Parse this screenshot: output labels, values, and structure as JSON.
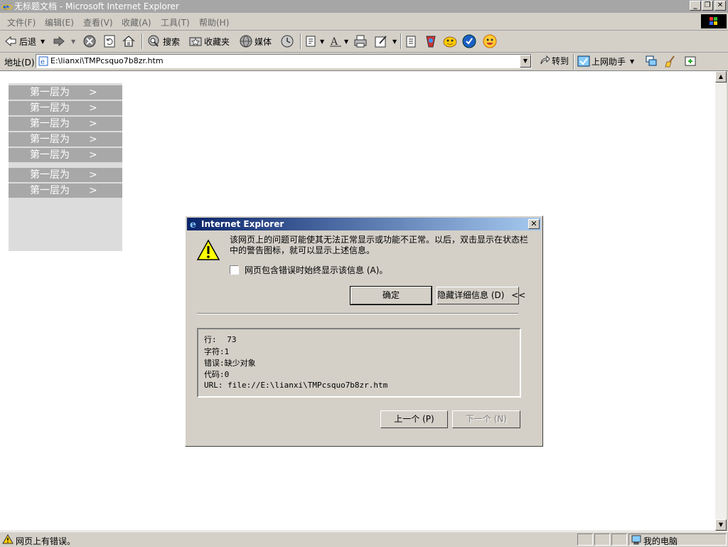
{
  "window": {
    "title": "无标题文档 - Microsoft Internet Explorer"
  },
  "menubar": {
    "items": [
      "文件(F)",
      "编辑(E)",
      "查看(V)",
      "收藏(A)",
      "工具(T)",
      "帮助(H)"
    ]
  },
  "toolbar": {
    "back_label": "后退",
    "search_label": "搜索",
    "favorites_label": "收藏夹",
    "media_label": "媒体"
  },
  "address": {
    "label": "地址(D)",
    "value": "E:\\lianxi\\TMPcsquo7b8zr.htm",
    "go_label": "转到",
    "assistant_label": "上网助手"
  },
  "page": {
    "menu_items": [
      {
        "label": "第一层为",
        "arrow": ">"
      },
      {
        "label": "第一层为",
        "arrow": ">"
      },
      {
        "label": "第一层为",
        "arrow": ">"
      },
      {
        "label": "第一层为",
        "arrow": ">"
      },
      {
        "label": "第一层为",
        "arrow": ">"
      },
      {
        "label": "第一层为",
        "arrow": ">"
      },
      {
        "label": "第一层为",
        "arrow": ">"
      }
    ]
  },
  "dialog": {
    "title": "Internet Explorer",
    "message": "该网页上的问题可能使其无法正常显示或功能不正常。以后，双击显示在状态栏中的警告图标，就可以显示上述信息。",
    "checkbox_label": "网页包含错误时始终显示该信息 (A)。",
    "ok_label": "确定",
    "hide_details_label": "隐藏详细信息 (D)",
    "hide_details_arrows": "<<",
    "details": {
      "line_label": "行:",
      "line_value": "73",
      "char_label": "字符:",
      "char_value": "1",
      "error_label": "错误:",
      "error_value": "缺少对象",
      "code_label": "代码:",
      "code_value": "0",
      "url_label": "URL:",
      "url_value": "file://E:\\lianxi\\TMPcsquo7b8zr.htm"
    },
    "prev_label": "上一个 (P)",
    "next_label": "下一个 (N)"
  },
  "status": {
    "text": "网页上有错误。",
    "zone": "我的电脑"
  },
  "colors": {
    "menu_row": "#a8a8a8",
    "menu_bg": "#dcdcdc",
    "dialog_title_start": "#0a246a",
    "dialog_title_end": "#a6caf0"
  }
}
